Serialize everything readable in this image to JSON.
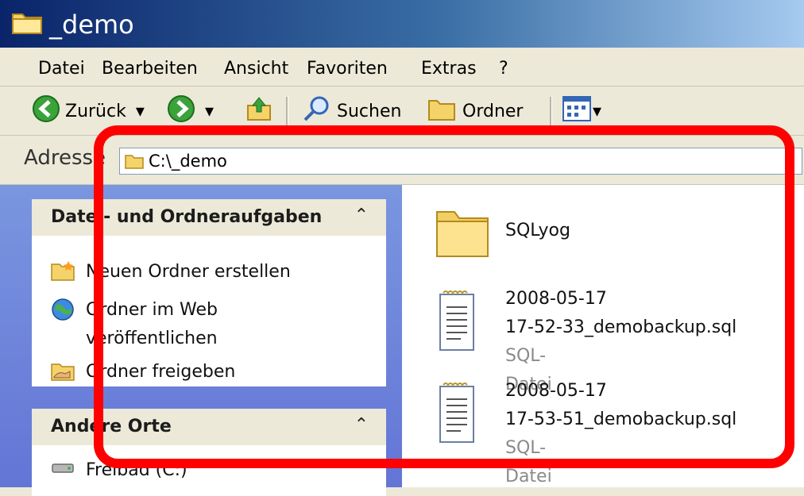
{
  "window": {
    "title": "_demo"
  },
  "menu": {
    "items": [
      "Datei",
      "Bearbeiten",
      "Ansicht",
      "Favoriten",
      "Extras",
      "?"
    ]
  },
  "toolbar": {
    "back_label": "Zurück",
    "search_label": "Suchen",
    "folders_label": "Ordner"
  },
  "address": {
    "label": "Adresse",
    "value": "C:\\_demo"
  },
  "tasks_panel": {
    "title": "Datei- und Ordneraufgaben",
    "items": [
      {
        "label": "Neuen Ordner erstellen",
        "icon": "new-folder-icon"
      },
      {
        "label": "Ordner im Web",
        "label2": "veröffentlichen",
        "icon": "publish-web-icon"
      },
      {
        "label": "Ordner freigeben",
        "icon": "share-folder-icon"
      }
    ]
  },
  "other_places": {
    "title": "Andere Orte",
    "items": [
      {
        "label": "Freibad (C:)",
        "icon": "drive-icon"
      }
    ]
  },
  "files": [
    {
      "name": "SQLyog",
      "type": "",
      "icon": "folder-icon"
    },
    {
      "name_line1": "2008-05-17",
      "name_line2": "17-52-33_demobackup.sql",
      "type": "SQL-Datei",
      "icon": "sql-file-icon"
    },
    {
      "name_line1": "2008-05-17",
      "name_line2": "17-53-51_demobackup.sql",
      "type": "SQL-Datei",
      "icon": "sql-file-icon"
    }
  ],
  "colors": {
    "highlight": "#ff0000",
    "titlebar": "#0a246a"
  }
}
